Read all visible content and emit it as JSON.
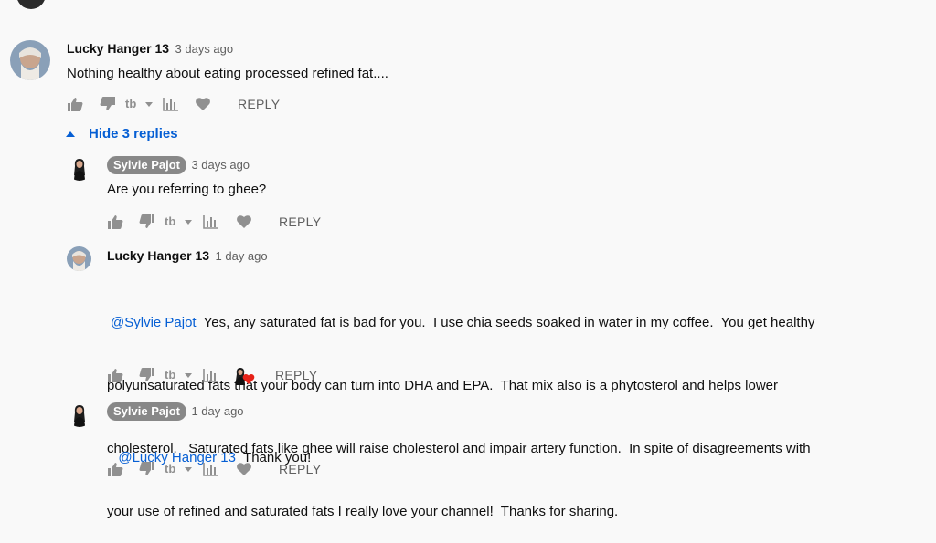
{
  "comment": {
    "author": "Lucky Hanger 13",
    "time": "3 days ago",
    "text": "Nothing healthy about eating processed refined fat....",
    "reply_label": "REPLY"
  },
  "hide_replies_label": "Hide 3 replies",
  "replies": [
    {
      "author": "Sylvie Pajot",
      "time": "3 days ago",
      "text": "Are you referring to ghee?",
      "reply_label": "REPLY"
    },
    {
      "author": "Lucky Hanger 13",
      "time": "1 day ago",
      "mention": "@Sylvie Pajot",
      "text_line1_rest": "  Yes, any saturated fat is bad for you.  I use chia seeds soaked in water in my coffee.  You get healthy",
      "text_line2": "polyunsaturated fats that your body can turn into DHA and EPA.  That mix also is a phytosterol and helps lower",
      "text_line3": "cholesterol.   Saturated fats like ghee will raise cholesterol and impair artery function.  In spite of disagreements with",
      "text_line4": "your use of refined and saturated fats I really love your channel!  Thanks for sharing.",
      "reply_label": "REPLY"
    },
    {
      "author": "Sylvie Pajot",
      "time": "1 day ago",
      "mention": "@Lucky Hanger 13",
      "text_rest": "  Thank you!",
      "reply_label": "REPLY"
    }
  ],
  "colors": {
    "background": "#f9f9f9",
    "link": "#065fd4",
    "heart_red": "#e62117",
    "icon_gray": "#909090"
  }
}
